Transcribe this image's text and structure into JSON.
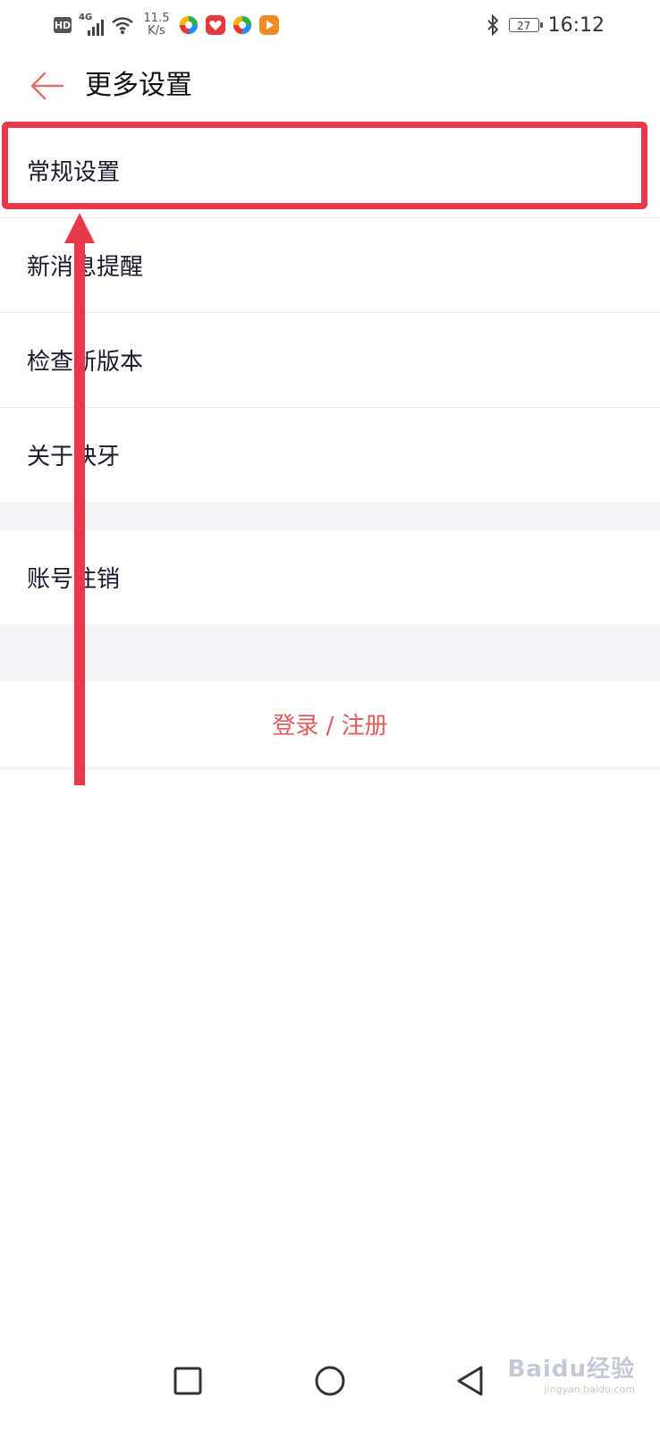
{
  "status_bar": {
    "hd": "HD",
    "network": "4G",
    "speed_value": "11.5",
    "speed_unit": "K/s",
    "battery": "27",
    "time": "16:12",
    "icons": [
      "hd-icon",
      "signal-icon",
      "wifi-icon",
      "app-icon-colorful",
      "app-icon-red",
      "app-icon-colorful",
      "app-icon-orange-play",
      "bluetooth-icon",
      "battery-icon"
    ]
  },
  "nav": {
    "title": "更多设置",
    "back_icon": "arrow-left-icon"
  },
  "list": {
    "items": [
      {
        "label": "常规设置"
      },
      {
        "label": "新消息提醒"
      },
      {
        "label": "检查新版本"
      },
      {
        "label": "关于快牙"
      },
      {
        "label": "账号注销"
      }
    ],
    "login_label": "登录 / 注册"
  },
  "annotation": {
    "color": "#e8394b"
  },
  "accent_color": "#e05a5a",
  "system_nav": {
    "icons": [
      "recent-apps-icon",
      "home-icon",
      "back-triangle-icon"
    ]
  },
  "watermark": {
    "text": "Baidu经验",
    "sub": "jingyan.baidu.com"
  }
}
